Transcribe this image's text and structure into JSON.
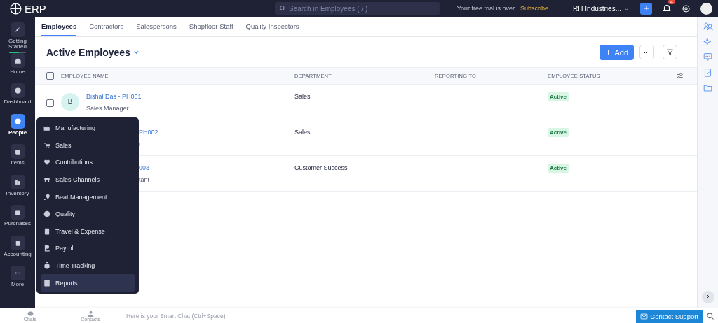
{
  "app": {
    "name": "ERP"
  },
  "topbar": {
    "search_placeholder": "Search in Employees ( / )",
    "trial_text": "Your free trial is over",
    "subscribe": "Subscribe",
    "org": "RH Industries...",
    "notification_count": "4"
  },
  "sidebar": {
    "items": [
      {
        "label": "Getting Started",
        "selected": false,
        "level": 0.6
      },
      {
        "label": "Home",
        "selected": false
      },
      {
        "label": "Dashboard",
        "selected": false
      },
      {
        "label": "People",
        "selected": true
      },
      {
        "label": "Items",
        "selected": false
      },
      {
        "label": "Inventory",
        "selected": false
      },
      {
        "label": "Purchases",
        "selected": false
      },
      {
        "label": "Accounting",
        "selected": false
      },
      {
        "label": "More",
        "selected": false
      }
    ]
  },
  "tabs": [
    {
      "label": "Employees",
      "selected": true
    },
    {
      "label": "Contractors",
      "selected": false
    },
    {
      "label": "Salespersons",
      "selected": false
    },
    {
      "label": "Shopfloor Staff",
      "selected": false
    },
    {
      "label": "Quality Inspectors",
      "selected": false
    }
  ],
  "view": {
    "title": "Active Employees",
    "add_button": "Add",
    "more_button": "···"
  },
  "table": {
    "select_all_checked": false,
    "columns": [
      "EMPLOYEE NAME",
      "DEPARTMENT",
      "REPORTING TO",
      "EMPLOYEE STATUS"
    ],
    "rows": [
      {
        "checked": false,
        "avatar": "B",
        "name": "Bishal Das - PH001",
        "role": "Sales Manager",
        "department": "Sales",
        "status": "Active"
      },
      {
        "name": "PH002",
        "role": "r",
        "department": "Sales",
        "status": "Active"
      },
      {
        "name": "003",
        "role": "tant",
        "department": "Customer Success",
        "status": "Active"
      }
    ]
  },
  "menu": {
    "items": [
      {
        "label": "Manufacturing",
        "selected": false
      },
      {
        "label": "Sales",
        "selected": false
      },
      {
        "label": "Contributions",
        "selected": false
      },
      {
        "label": "Sales Channels",
        "selected": false
      },
      {
        "label": "Beat Management",
        "selected": false
      },
      {
        "label": "Quality",
        "selected": false
      },
      {
        "label": "Travel & Expense",
        "selected": false
      },
      {
        "label": "Payroll",
        "selected": false
      },
      {
        "label": "Time Tracking",
        "selected": false
      },
      {
        "label": "Reports",
        "selected": true
      }
    ]
  },
  "bottombar": {
    "chats": "Chats",
    "contacts": "Contacts",
    "chat_placeholder": "Here is your Smart Chat (Ctrl+Space)",
    "support": "Contact Support"
  }
}
